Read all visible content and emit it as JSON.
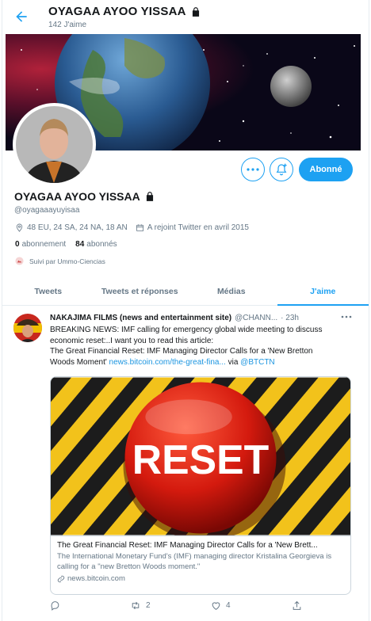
{
  "header": {
    "title": "OYAGAA AYOO YISSAA",
    "subtitle": "142 J'aime"
  },
  "profile": {
    "name": "OYAGAA AYOO YISSAA",
    "handle": "@oyagaaayuyisaa",
    "location": "48 EU, 24 SA, 24 NA, 18 AN",
    "joined": "A rejoint Twitter en avril 2015",
    "following_count": "0",
    "following_label": "abonnement",
    "followers_count": "84",
    "followers_label": "abonnés",
    "followed_by": "Suivi par Ummo-Ciencias",
    "follow_button": "Abonné"
  },
  "tabs": [
    {
      "label": "Tweets",
      "active": false
    },
    {
      "label": "Tweets et réponses",
      "active": false
    },
    {
      "label": "Médias",
      "active": false
    },
    {
      "label": "J'aime",
      "active": true
    }
  ],
  "tweet": {
    "author": "NAKAJIMA FILMS (news and entertainment site)",
    "handle": "@CHANN...",
    "time": "· 23h",
    "text_line1": "BREAKING NEWS: IMF calling for emergency global wide meeting to discuss",
    "text_line2": "economic reset:..I want you to read this article:",
    "text_line3": "The Great Financial Reset: IMF Managing Director Calls for a 'New Bretton",
    "text_line4_pre": "Woods Moment' ",
    "link": "news.bitcoin.com/the-great-fina...",
    "via": " via ",
    "mention": "@BTCTN",
    "card": {
      "image_text": "RESET",
      "title": "The Great Financial Reset: IMF Managing Director Calls for a 'New Brett...",
      "description": "The International Monetary Fund's (IMF) managing director Kristalina Georgieva is calling for a \"new Bretton Woods moment.\"",
      "domain": "news.bitcoin.com"
    },
    "retweets": "2",
    "likes": "4"
  },
  "colors": {
    "accent": "#1da1f2",
    "text": "#14171a",
    "secondary": "#657786",
    "border": "#e6ecf0"
  }
}
